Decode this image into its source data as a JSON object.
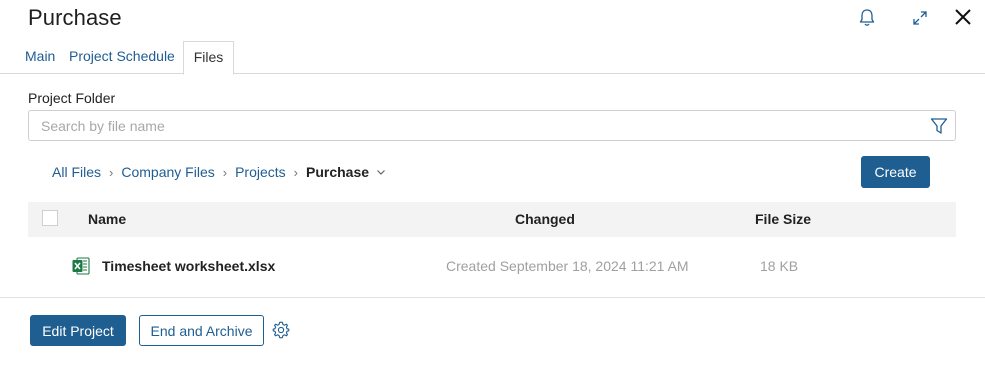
{
  "window": {
    "title": "Purchase",
    "icons": [
      "bell-icon",
      "expand-icon",
      "close-icon"
    ]
  },
  "tabs": [
    {
      "label": "Main",
      "active": false
    },
    {
      "label": "Project Schedule",
      "active": false
    },
    {
      "label": "Files",
      "active": true
    }
  ],
  "folder": {
    "label": "Project Folder",
    "search_placeholder": "Search by file name",
    "search_value": ""
  },
  "breadcrumb": {
    "items": [
      "All Files",
      "Company Files",
      "Projects"
    ],
    "current": "Purchase"
  },
  "toolbar": {
    "create_label": "Create"
  },
  "table": {
    "columns": [
      "Name",
      "Changed",
      "File Size"
    ],
    "rows": [
      {
        "icon": "excel-file-icon",
        "name": "Timesheet worksheet.xlsx",
        "changed": "Created September 18, 2024 11:21 AM",
        "size": "18 KB"
      }
    ]
  },
  "footer": {
    "edit_label": "Edit Project",
    "archive_label": "End and Archive",
    "settings_icon": "gear-icon"
  },
  "colors": {
    "primary": "#1e5e91",
    "link": "#1f5d93",
    "excel_green": "#1d7a45",
    "muted_text": "#a0a0a0"
  }
}
